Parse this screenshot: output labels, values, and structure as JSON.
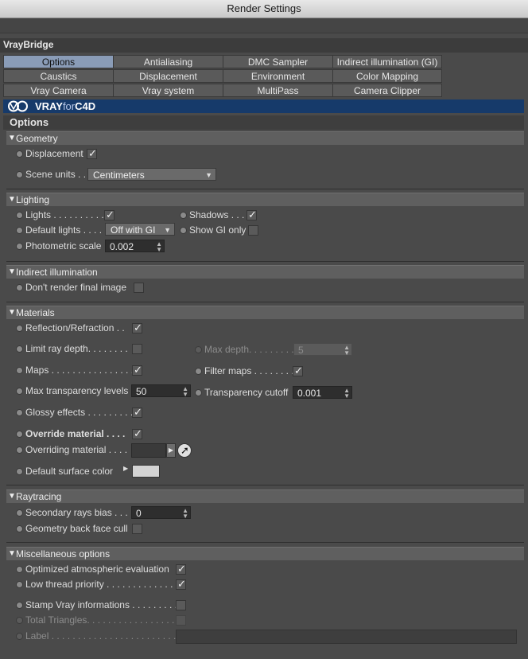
{
  "window": {
    "title": "Render Settings"
  },
  "section_header": "VrayBridge",
  "tabs": [
    {
      "label": "Options",
      "active": true
    },
    {
      "label": "Antialiasing"
    },
    {
      "label": "DMC Sampler"
    },
    {
      "label": "Indirect illumination (GI)"
    },
    {
      "label": "Caustics"
    },
    {
      "label": "Displacement"
    },
    {
      "label": "Environment"
    },
    {
      "label": "Color Mapping"
    },
    {
      "label": "Vray Camera"
    },
    {
      "label": "Vray system"
    },
    {
      "label": "MultiPass"
    },
    {
      "label": "Camera Clipper"
    }
  ],
  "brand": {
    "vray": "VRAY",
    "for": "for",
    "c4d": "C4D",
    "color": "#163a6a"
  },
  "options_title": "Options",
  "geometry": {
    "title": "Geometry",
    "displacement": {
      "label": "Displacement",
      "checked": true
    },
    "scene_units": {
      "label": "Scene units . .",
      "value": "Centimeters"
    }
  },
  "lighting": {
    "title": "Lighting",
    "lights": {
      "label": "Lights . . . . . . . . . . .",
      "checked": true
    },
    "shadows": {
      "label": "Shadows . . .",
      "checked": true
    },
    "default_lights": {
      "label": "Default lights . . . .",
      "value": "Off with GI"
    },
    "show_gi_only": {
      "label": "Show GI only",
      "checked": false
    },
    "photometric_scale": {
      "label": "Photometric scale",
      "value": "0.002"
    }
  },
  "indirect": {
    "title": "Indirect illumination",
    "dont_render_final": {
      "label": "Don't render final image",
      "checked": false
    }
  },
  "materials": {
    "title": "Materials",
    "reflection_refraction": {
      "label": "Reflection/Refraction . .",
      "checked": true
    },
    "limit_ray_depth": {
      "label": "Limit ray depth. . . . . . . .",
      "checked": false
    },
    "max_depth": {
      "label": "Max depth. . . . . . . . .",
      "value": "5"
    },
    "maps": {
      "label": "Maps . . . . . . . . . . . . . . . .",
      "checked": true
    },
    "filter_maps": {
      "label": "Filter maps . . . . . . . .",
      "checked": true
    },
    "max_transparency_levels": {
      "label": "Max transparency levels",
      "value": "50"
    },
    "transparency_cutoff": {
      "label": "Transparency cutoff",
      "value": "0.001"
    },
    "glossy_effects": {
      "label": "Glossy effects . . . . . . . . .",
      "checked": true
    },
    "override_material": {
      "label": "Override material . . . .",
      "checked": true
    },
    "overriding_material": {
      "label": "Overriding material . . . ."
    },
    "default_surface_color": {
      "label": "Default surface color",
      "color": "#d3d3d3"
    }
  },
  "raytracing": {
    "title": "Raytracing",
    "secondary_rays_bias": {
      "label": "Secondary rays bias . . .",
      "value": "0"
    },
    "geometry_back_face_cull": {
      "label": "Geometry back face cull",
      "checked": false
    }
  },
  "misc": {
    "title": "Miscellaneous options",
    "optimized_atmospheric": {
      "label": "Optimized atmospheric evaluation",
      "checked": true
    },
    "low_thread_priority": {
      "label": "Low thread priority . . . . . . . . . . . . .",
      "checked": true
    },
    "stamp_vray": {
      "label": "Stamp Vray informations . . . . . . . . .",
      "checked": false
    },
    "total_triangles": {
      "label": "Total Triangles. . . . . . . . . . . . . . . . .",
      "checked": false
    },
    "label_field": {
      "label": "Label . . . . . . . . . . . . . . . . . . . . . . . .",
      "value": ""
    }
  }
}
